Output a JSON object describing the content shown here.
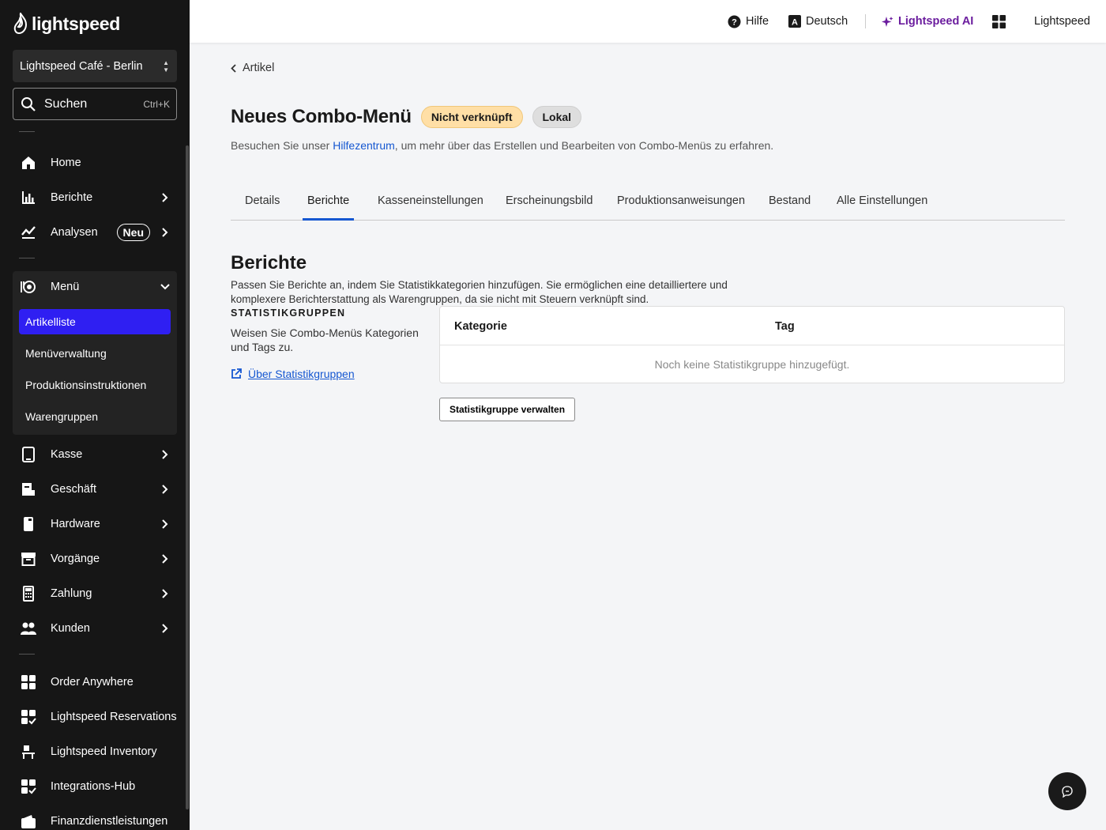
{
  "sidebar": {
    "logo_text": "lightspeed",
    "store": "Lightspeed Café - Berlin",
    "search_label": "Suchen",
    "search_shortcut": "Ctrl+K",
    "items": [
      {
        "label": "Home",
        "icon": "home-icon"
      },
      {
        "label": "Berichte",
        "icon": "bar-chart-icon"
      },
      {
        "label": "Analysen",
        "icon": "trend-icon",
        "badge": "Neu"
      },
      {
        "label": "Menü",
        "icon": "menu-dish-icon"
      },
      {
        "label": "Kasse",
        "icon": "tablet-icon"
      },
      {
        "label": "Geschäft",
        "icon": "store-icon"
      },
      {
        "label": "Hardware",
        "icon": "device-icon"
      },
      {
        "label": "Vorgänge",
        "icon": "archive-icon"
      },
      {
        "label": "Zahlung",
        "icon": "calculator-icon"
      },
      {
        "label": "Kunden",
        "icon": "people-icon"
      },
      {
        "label": "Order Anywhere",
        "icon": "grid-plus-icon"
      },
      {
        "label": "Lightspeed Reservations",
        "icon": "grid-check-icon"
      },
      {
        "label": "Lightspeed Inventory",
        "icon": "inventory-icon"
      },
      {
        "label": "Integrations-Hub",
        "icon": "grid-check-icon"
      },
      {
        "label": "Finanzdienstleistungen",
        "icon": "wallet-icon"
      }
    ],
    "menu_sub": [
      "Artikelliste",
      "Menüverwaltung",
      "Produktionsinstruktionen",
      "Warengruppen"
    ]
  },
  "topbar": {
    "help": "Hilfe",
    "language": "Deutsch",
    "ai": "Lightspeed AI",
    "account": "Lightspeed"
  },
  "page": {
    "back": "Artikel",
    "title": "Neues Combo-Menü",
    "pill_status": "Nicht verknüpft",
    "pill_scope": "Lokal",
    "help_pre": "Besuchen Sie unser ",
    "help_link": "Hilfezentrum",
    "help_post": ", um mehr über das Erstellen und Bearbeiten von Combo-Menüs zu erfahren.",
    "tabs": [
      "Details",
      "Berichte",
      "Kasseneinstellungen",
      "Erscheinungsbild",
      "Produktionsanweisungen",
      "Bestand",
      "Alle Einstellungen"
    ]
  },
  "reports": {
    "title": "Berichte",
    "description": "Passen Sie Berichte an, indem Sie Statistikkategorien hinzufügen. Sie ermöglichen eine detailliertere und komplexere Berichterstattung als Warengruppen, da sie nicht mit Steuern verknüpft sind.",
    "stat_heading": "STATISTIKGRUPPEN",
    "stat_description": "Weisen Sie Combo-Menüs Kategorien und Tags zu.",
    "stat_link": "Über Statistikgruppen",
    "col_category": "Kategorie",
    "col_tag": "Tag",
    "empty": "Noch keine Statistikgruppe hinzugefügt.",
    "manage_button": "Statistikgruppe verwalten"
  },
  "colors": {
    "sidebar_bg": "#161616",
    "accent_active": "#2f1ff2",
    "link": "#1557d1",
    "ai": "#6b1d9e",
    "pill_orange": "#ffdfa6"
  }
}
